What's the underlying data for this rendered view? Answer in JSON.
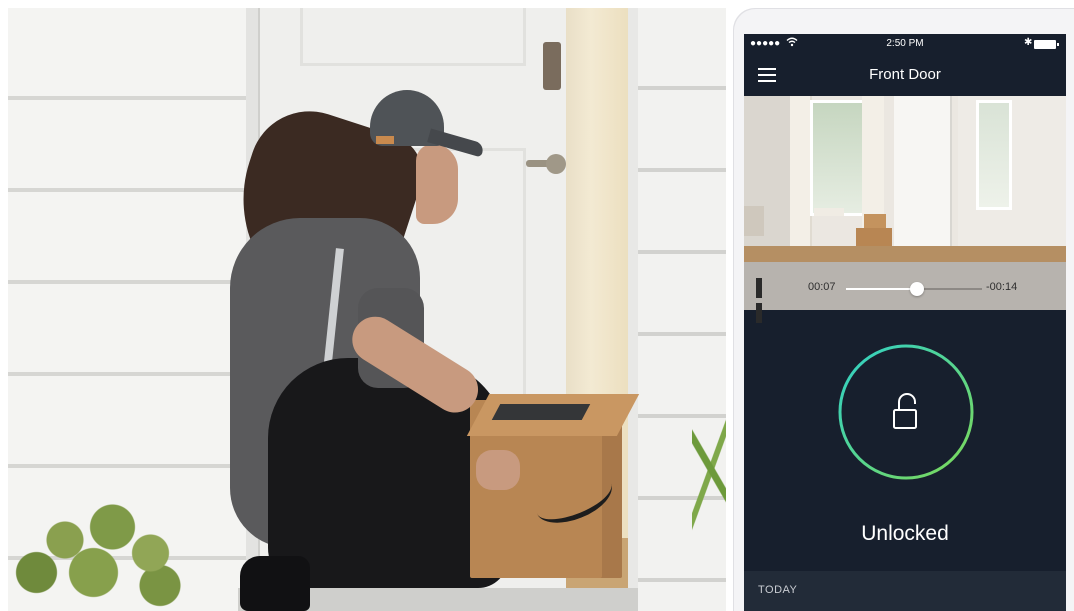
{
  "phone": {
    "status_bar": {
      "signal": "●●●●●",
      "wifi_icon": "wifi-icon",
      "time": "2:50 PM",
      "bluetooth": "✱",
      "battery_icon": "battery-icon"
    },
    "nav": {
      "menu_icon": "hamburger-menu-icon",
      "title": "Front Door"
    },
    "player": {
      "pause_icon": "pause-icon",
      "elapsed": "00:07",
      "remaining": "-00:14",
      "progress": 0.52
    },
    "lock": {
      "icon": "unlocked-padlock-icon",
      "status": "Unlocked",
      "ring_colors": [
        "#2fd0c8",
        "#7ed957"
      ]
    },
    "activity": {
      "section_label": "TODAY"
    }
  },
  "colors": {
    "app_background": "#171f2d",
    "controls_background": "#b7b3ae",
    "text_primary": "#ffffff"
  }
}
